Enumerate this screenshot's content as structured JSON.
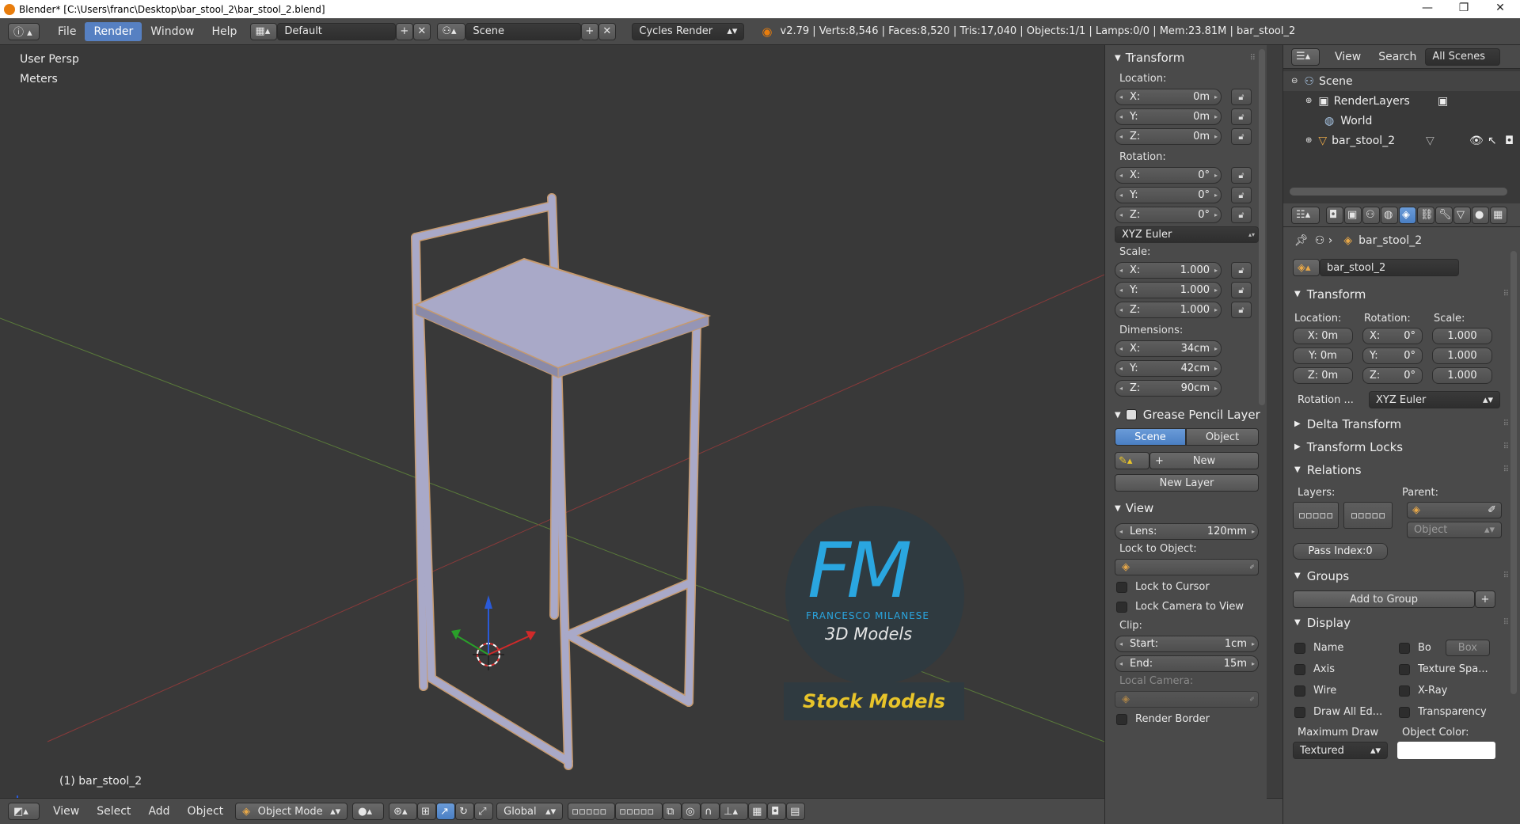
{
  "titlebar": {
    "title": "Blender* [C:\\Users\\franc\\Desktop\\bar_stool_2\\bar_stool_2.blend]",
    "minimize": "—",
    "maximize": "❐",
    "close": "✕"
  },
  "menu": {
    "file": "File",
    "render": "Render",
    "window": "Window",
    "help": "Help"
  },
  "topbar": {
    "layout": "Default",
    "scene": "Scene",
    "engine": "Cycles Render",
    "stats": "v2.79 | Verts:8,546 | Faces:8,520 | Tris:17,040 | Objects:1/1 | Lamps:0/0 | Mem:23.81M | bar_stool_2"
  },
  "viewport": {
    "view_name": "User Persp",
    "units": "Meters",
    "object_label": "(1) bar_stool_2",
    "logo_fm": "FM",
    "logo_name": "FRANCESCO MILANESE",
    "logo_3d": "3D Models",
    "logo_stock": "Stock Models"
  },
  "bottombar": {
    "view": "View",
    "select": "Select",
    "add": "Add",
    "object": "Object",
    "mode": "Object Mode",
    "orientation": "Global"
  },
  "npanel": {
    "transform_title": "Transform",
    "location_label": "Location:",
    "location": [
      {
        "axis": "X:",
        "value": "0m"
      },
      {
        "axis": "Y:",
        "value": "0m"
      },
      {
        "axis": "Z:",
        "value": "0m"
      }
    ],
    "rotation_label": "Rotation:",
    "rotation": [
      {
        "axis": "X:",
        "value": "0°"
      },
      {
        "axis": "Y:",
        "value": "0°"
      },
      {
        "axis": "Z:",
        "value": "0°"
      }
    ],
    "rotation_mode": "XYZ Euler",
    "scale_label": "Scale:",
    "scale": [
      {
        "axis": "X:",
        "value": "1.000"
      },
      {
        "axis": "Y:",
        "value": "1.000"
      },
      {
        "axis": "Z:",
        "value": "1.000"
      }
    ],
    "dimensions_label": "Dimensions:",
    "dimensions": [
      {
        "axis": "X:",
        "value": "34cm"
      },
      {
        "axis": "Y:",
        "value": "42cm"
      },
      {
        "axis": "Z:",
        "value": "90cm"
      }
    ],
    "grease_title": "Grease Pencil Layer",
    "grease_scene": "Scene",
    "grease_object": "Object",
    "grease_new": "New",
    "grease_new_layer": "New Layer",
    "view_title": "View",
    "lens_label": "Lens:",
    "lens_value": "120mm",
    "lock_to_object": "Lock to Object:",
    "lock_to_cursor": "Lock to Cursor",
    "lock_camera": "Lock Camera to View",
    "clip_label": "Clip:",
    "clip_start_label": "Start:",
    "clip_start": "1cm",
    "clip_end_label": "End:",
    "clip_end": "15m",
    "local_camera": "Local Camera:",
    "render_border": "Render Border"
  },
  "outliner": {
    "view": "View",
    "search": "Search",
    "scope": "All Scenes",
    "items": [
      "Scene",
      "RenderLayers",
      "World",
      "bar_stool_2"
    ]
  },
  "properties": {
    "breadcrumb": "bar_stool_2",
    "object_name": "bar_stool_2",
    "transform_title": "Transform",
    "location_label": "Location:",
    "rotation_label": "Rotation:",
    "scale_label": "Scale:",
    "loc": [
      "X: 0m",
      "Y: 0m",
      "Z: 0m"
    ],
    "rot_axes": [
      "X:",
      "Y:",
      "Z:"
    ],
    "rot_vals": [
      "0°",
      "0°",
      "0°"
    ],
    "scl": [
      "1.000",
      "1.000",
      "1.000"
    ],
    "rotation_mode_label": "Rotation ...",
    "rotation_mode": "XYZ Euler",
    "delta_transform": "Delta Transform",
    "transform_locks": "Transform Locks",
    "relations": "Relations",
    "layers_label": "Layers:",
    "parent_label": "Parent:",
    "parent_type": "Object",
    "pass_index": "Pass Index:0",
    "groups": "Groups",
    "add_to_group": "Add to Group",
    "display": "Display",
    "disp_name": "Name",
    "disp_bo": "Bo",
    "disp_box": "Box",
    "disp_axis": "Axis",
    "disp_texspace": "Texture Spa...",
    "disp_wire": "Wire",
    "disp_xray": "X-Ray",
    "disp_drawall": "Draw All Ed...",
    "disp_transparency": "Transparency",
    "max_draw_label": "Maximum Draw",
    "max_draw": "Textured",
    "object_color_label": "Object Color:"
  },
  "colors": {
    "accent": "#5680c2",
    "panel": "#4a4a4a",
    "viewport": "#393939",
    "logo_blue": "#2aa6e0",
    "logo_gold": "#e8c42a"
  }
}
